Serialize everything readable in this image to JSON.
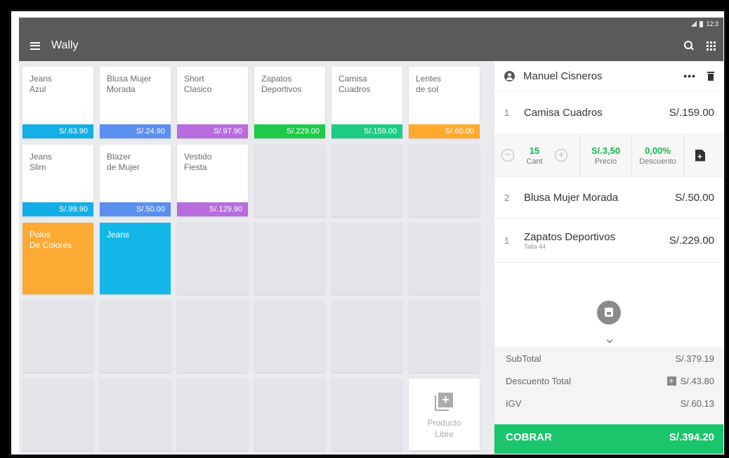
{
  "statusbar": {
    "time": "12:3"
  },
  "appbar": {
    "title": "Wally"
  },
  "catalog": {
    "products": [
      {
        "name": "Jeans\nAzul",
        "price": "S/.63.90",
        "color": "#13aee6"
      },
      {
        "name": "Blusa Mujer\nMorada",
        "price": "S/.24.90",
        "color": "#5b8ff0"
      },
      {
        "name": "Short\nClasico",
        "price": "S/.97.90",
        "color": "#b86cde"
      },
      {
        "name": "Zapatos\nDeportivos",
        "price": "S/.229.00",
        "color": "#1fca4b"
      },
      {
        "name": "Camisa\nCuadros",
        "price": "S/.159.00",
        "color": "#1dcc85"
      },
      {
        "name": "Lentes\nde sol",
        "price": "S/.60.00",
        "color": "#ffaa2c"
      },
      {
        "name": "Jeans\nSlim",
        "price": "S/.99.90",
        "color": "#13aee6"
      },
      {
        "name": "Blazer\nde Mujer",
        "price": "S/.50.00",
        "color": "#5b8ff0"
      },
      {
        "name": "Vestido\nFiesta",
        "price": "S/.129.90",
        "color": "#b86cde"
      }
    ],
    "categories": [
      {
        "name": "Polos\nDe Colores",
        "color": "#fbaa34"
      },
      {
        "name": "Jeans",
        "color": "#12b7e8"
      }
    ],
    "libre_label": "Producto\nLibre"
  },
  "order": {
    "customer": "Manuel Cisneros",
    "more": "•••",
    "lines": [
      {
        "qty": "1",
        "name": "Camisa Cuadros",
        "amount": "S/.159.00",
        "note": ""
      },
      {
        "qty": "2",
        "name": "Blusa Mujer Morada",
        "amount": "S/.50.00",
        "note": ""
      },
      {
        "qty": "1",
        "name": "Zapatos Deportivos",
        "amount": "S/.229.00",
        "note": "Talla 44"
      }
    ],
    "editor": {
      "qty": "15",
      "qty_label": "Cant",
      "price": "S/.3,50",
      "price_label": "Precio",
      "discount": "0,00%",
      "discount_label": "Descuento"
    },
    "totals": {
      "subtotal_label": "SubTotal",
      "subtotal": "S/.379.19",
      "discount_label": "Descuento Total",
      "discount": "S/.43.80",
      "igv_label": "IGV",
      "igv": "S/.60.13"
    },
    "cobrar_label": "COBRAR",
    "cobrar_amount": "S/.394.20"
  },
  "colors": {
    "appbar": "#5a5a5a",
    "accent_green": "#1bc56c"
  }
}
